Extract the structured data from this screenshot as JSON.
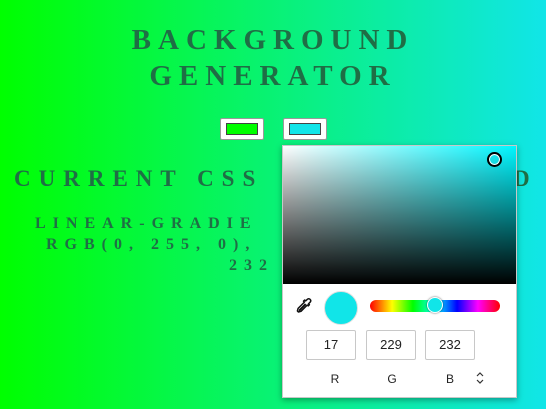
{
  "page": {
    "title_line1": "BACKGROUND",
    "title_line2": "GENERATOR",
    "heading_start": "CURRENT CSS",
    "heading_end": "D",
    "css_line1": "LINEAR-GRADIE",
    "css_line2": "RGB(0, 255, 0),",
    "css_line3": "232"
  },
  "color_inputs": [
    {
      "name": "color1",
      "value": "#00ff00"
    },
    {
      "name": "color2",
      "value": "#11e5e8"
    }
  ],
  "picker": {
    "hex": "#11e5e8",
    "r": "17",
    "g": "229",
    "b": "232",
    "label_r": "R",
    "label_g": "G",
    "label_b": "B",
    "mode_toggle": "⇕"
  },
  "icons": {
    "eyedropper": "eyedropper-icon",
    "mode": "chevron-up-down-icon"
  }
}
